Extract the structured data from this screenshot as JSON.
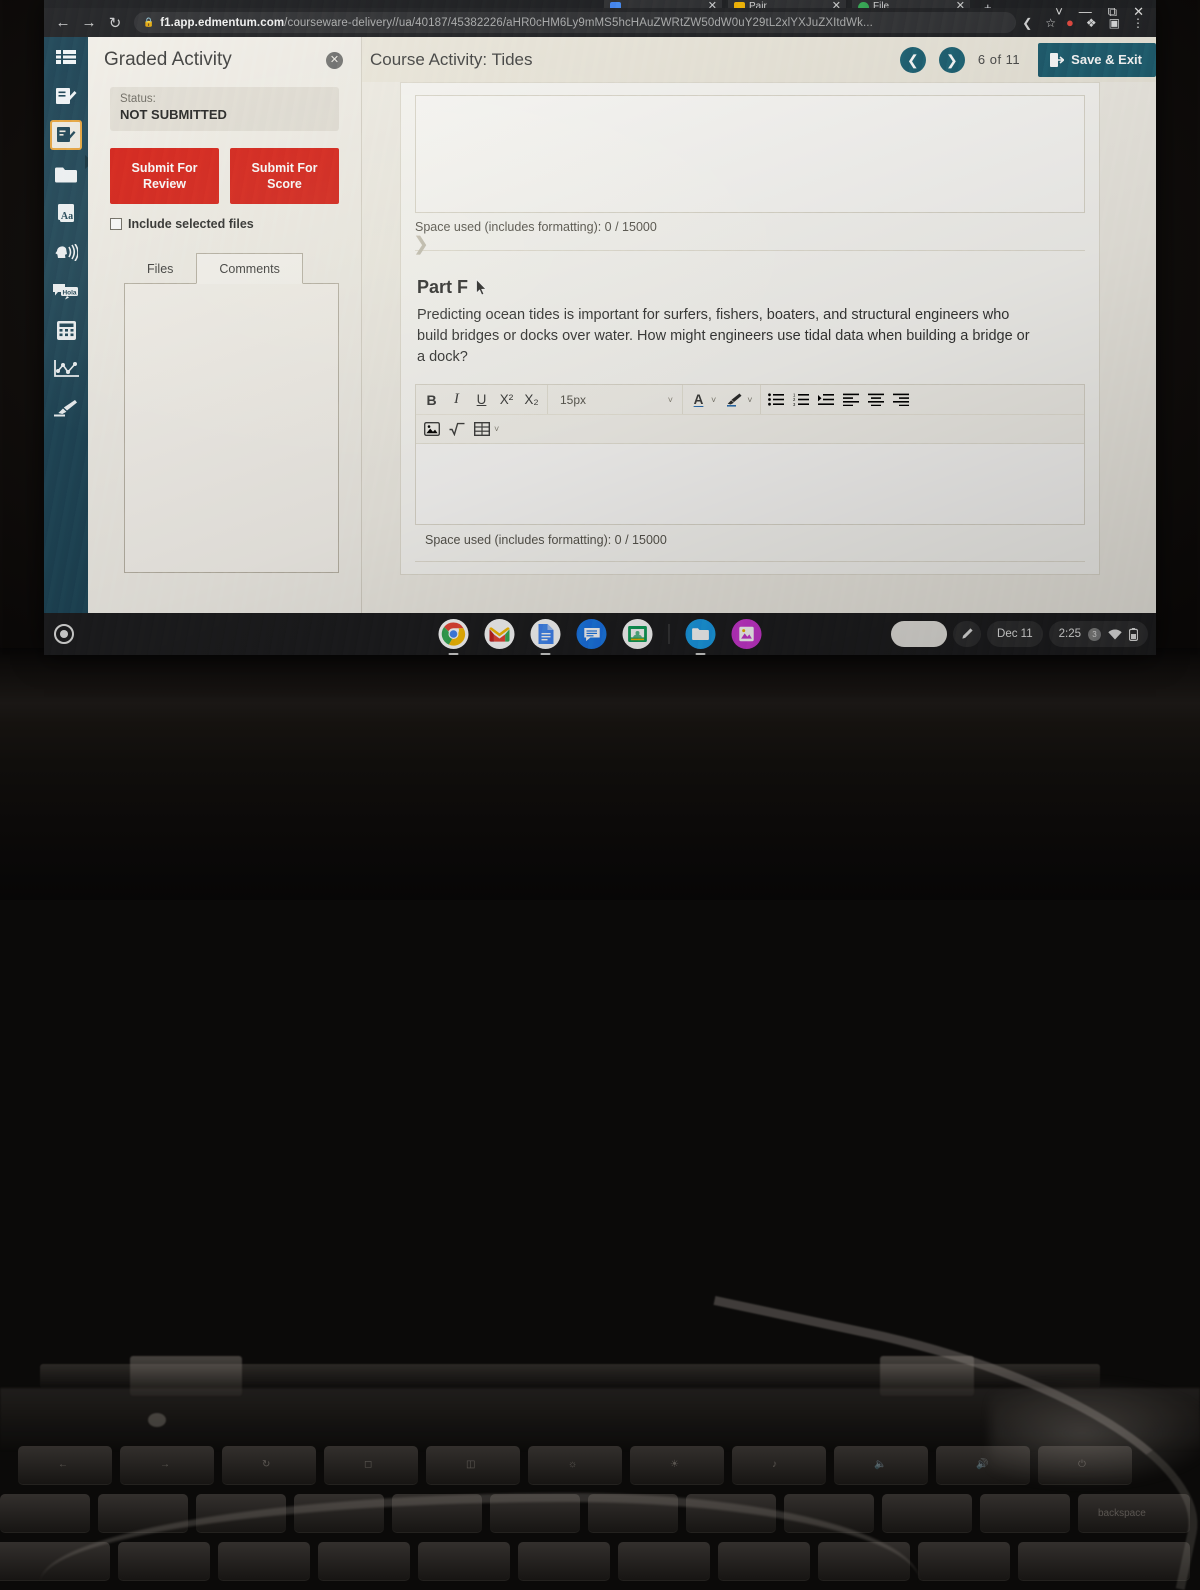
{
  "browser": {
    "nav": {
      "back_icon": "back-arrow-icon",
      "forward_icon": "forward-arrow-icon",
      "reload_icon": "reload-icon"
    },
    "omnibox": {
      "lock_icon": "lock-icon",
      "url_host": "f1.app.edmentum.com",
      "url_path": "/courseware-delivery//ua/40187/45382226/aHR0cHM6Ly9mMS5hcHAuZWRtZW50dW0uY29tL2xlYXJuZXItdWk...",
      "share_icon": "share-icon",
      "bookmark_icon": "star-icon"
    },
    "extensions": {
      "pin_icon": "pinterest-save-icon",
      "puzzle_icon": "extensions-puzzle-icon",
      "panel_icon": "side-panel-icon",
      "menu_icon": "three-dot-menu-icon"
    },
    "window_controls": {
      "chevron_icon": "chevron-down-icon",
      "minimize_icon": "minimize-icon",
      "restore_icon": "restore-window-icon",
      "close_icon": "close-window-icon"
    },
    "tabs": [
      {
        "label": "Pair",
        "close_icon": "tab-close-icon"
      },
      {
        "label": "File",
        "close_icon": "tab-close-icon"
      }
    ],
    "new_tab_label": "+"
  },
  "readwrite_toolbar": {
    "items": [
      {
        "name": "toolbar-list-icon",
        "icon": "list-icon"
      },
      {
        "name": "toolbar-edit-note-icon",
        "icon": "edit-note-icon"
      },
      {
        "name": "toolbar-check-document-icon",
        "icon": "check-document-icon",
        "selected": true
      },
      {
        "name": "toolbar-folder-icon",
        "icon": "folder-icon"
      },
      {
        "name": "toolbar-dictionary-icon",
        "icon": "dictionary-aa-icon",
        "label": "Aa"
      },
      {
        "name": "toolbar-text-to-speech-icon",
        "icon": "speech-icon"
      },
      {
        "name": "toolbar-translate-icon",
        "icon": "translate-icon",
        "label": "Hola"
      },
      {
        "name": "toolbar-calculator-icon",
        "icon": "calculator-icon"
      },
      {
        "name": "toolbar-graph-icon",
        "icon": "graph-icon"
      },
      {
        "name": "toolbar-highlighter-icon",
        "icon": "highlighter-pen-icon"
      }
    ]
  },
  "left_panel": {
    "title": "Graded Activity",
    "close_icon": "close-circle-icon",
    "status_label": "Status:",
    "status_value": "NOT SUBMITTED",
    "submit_review_label": "Submit For Review",
    "submit_score_label": "Submit For Score",
    "include_files_label": "Include selected files",
    "tabs": [
      {
        "label": "Files",
        "active": false
      },
      {
        "label": "Comments",
        "active": true
      }
    ]
  },
  "activity": {
    "title": "Course Activity: Tides",
    "prev_icon": "chevron-left-icon",
    "next_icon": "chevron-right-icon",
    "page_indicator": "6 of 11",
    "save_exit_label": "Save & Exit",
    "save_exit_icon": "exit-door-icon",
    "scroll_chevron_icon": "chevron-right-icon",
    "previous_answer": {
      "space_used": "Space used (includes formatting): 0 / 15000"
    },
    "part": {
      "heading": "Part F",
      "question": "Predicting ocean tides is important for surfers, fishers, boaters, and structural engineers who build bridges or docks over water. How might engineers use tidal data when building a bridge or a dock?",
      "cursor_icon": "mouse-pointer-icon",
      "space_used": "Space used (includes formatting): 0 / 15000",
      "answer_value": ""
    },
    "editor_toolbar": {
      "bold": "B",
      "italic": "I",
      "underline": "U",
      "superscript": "X²",
      "subscript": "X₂",
      "font_size": "15px",
      "font_size_caret": "chevron-down-icon",
      "text_color": "A",
      "text_color_caret": "chevron-down-icon",
      "highlight_icon": "highlighter-icon",
      "highlight_caret": "chevron-down-icon",
      "bullet_list_icon": "bullet-list-icon",
      "numbered_list_icon": "numbered-list-icon",
      "indent_icon": "indent-icon",
      "align_left_icon": "align-left-icon",
      "align_center_icon": "align-center-icon",
      "align_right_icon": "align-right-icon",
      "image_icon": "insert-image-icon",
      "equation_icon": "insert-equation-icon",
      "table_icon": "insert-table-icon",
      "table_caret": "chevron-down-icon"
    }
  },
  "shelf": {
    "launcher_icon": "launcher-circle-icon",
    "apps": [
      {
        "name": "app-chrome",
        "icon": "chrome-icon"
      },
      {
        "name": "app-gmail",
        "icon": "gmail-icon"
      },
      {
        "name": "app-docs",
        "icon": "google-docs-icon"
      },
      {
        "name": "app-chat",
        "icon": "chat-icon"
      },
      {
        "name": "app-classroom",
        "icon": "google-classroom-icon"
      },
      {
        "name": "app-files",
        "icon": "files-folder-icon"
      },
      {
        "name": "app-photos",
        "icon": "photos-icon"
      }
    ],
    "tray": {
      "stylus_icon": "stylus-pen-icon",
      "date": "Dec 11",
      "time": "2:25",
      "notification_count": "3",
      "wifi_icon": "wifi-icon",
      "battery_icon": "battery-icon"
    }
  },
  "colors": {
    "accent_teal": "#1d5b6e",
    "submit_red": "#d81f16",
    "rw_toolbar": "#1d4355",
    "panel_bg": "#f3f0e9"
  }
}
